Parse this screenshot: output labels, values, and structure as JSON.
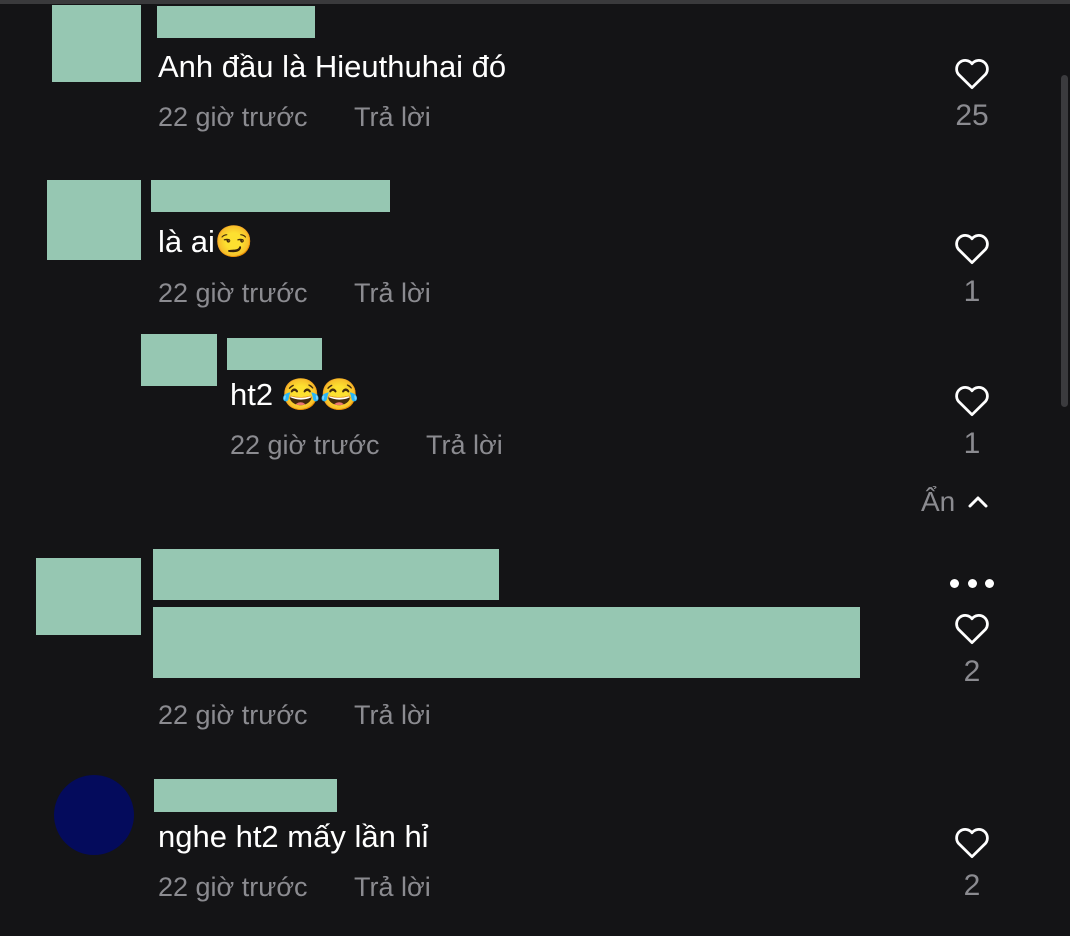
{
  "comments": [
    {
      "text": "Anh đầu là Hieuthuhai đó",
      "time": "22 giờ trước",
      "reply": "Trả lời",
      "likes": "25"
    },
    {
      "text": "là ai😏",
      "time": "22 giờ trước",
      "reply": "Trả lời",
      "likes": "1"
    },
    {
      "text": "ht2 😂😂",
      "time": "22 giờ trước",
      "reply": "Trả lời",
      "likes": "1"
    },
    {
      "text": "",
      "time": "22 giờ trước",
      "reply": "Trả lời",
      "likes": "2"
    },
    {
      "text": "nghe ht2 mấy lần hỉ",
      "time": "22 giờ trước",
      "reply": "Trả lời",
      "likes": "2"
    }
  ],
  "hide_replies": {
    "label": "Ẩn",
    "icon": "chevron-up-icon"
  },
  "icons": {
    "like": "heart-outline-icon",
    "more": "more-horizontal-icon"
  },
  "colors": {
    "background": "#141416",
    "redaction": "#96c7b2",
    "muted": "#8b8b90",
    "avatar": "#040b5c"
  }
}
